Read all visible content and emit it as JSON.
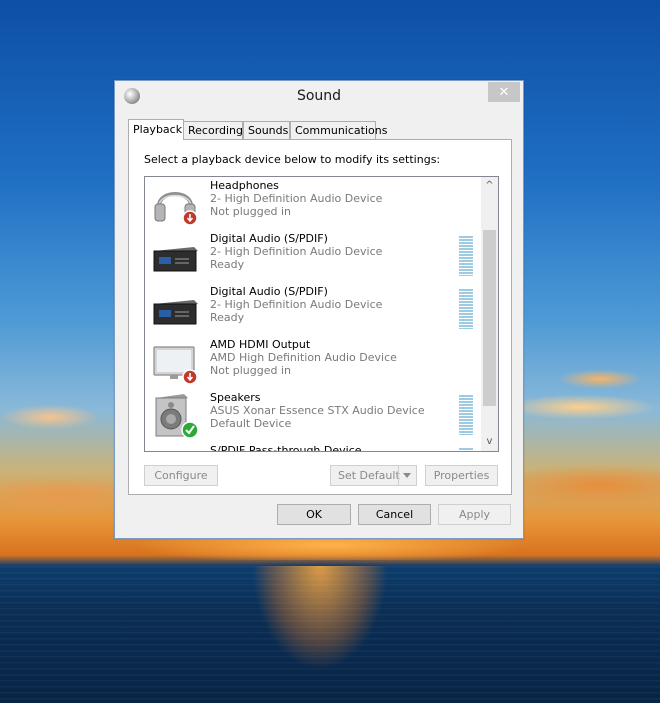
{
  "window": {
    "title": "Sound",
    "close_glyph": "✕"
  },
  "tabs": [
    {
      "label": "Playback",
      "active": true
    },
    {
      "label": "Recording",
      "active": false
    },
    {
      "label": "Sounds",
      "active": false
    },
    {
      "label": "Communications",
      "active": false
    }
  ],
  "playback": {
    "instructions": "Select a playback device below to modify its settings:",
    "devices": [
      {
        "name": "Headphones",
        "description": "2- High Definition Audio Device",
        "status": "Not plugged in",
        "icon": "headphones-icon",
        "badge": "unplugged-badge",
        "has_meter": false
      },
      {
        "name": "Digital Audio (S/PDIF)",
        "description": "2- High Definition Audio Device",
        "status": "Ready",
        "icon": "spdif-device-icon",
        "badge": "",
        "has_meter": true
      },
      {
        "name": "Digital Audio (S/PDIF)",
        "description": "2- High Definition Audio Device",
        "status": "Ready",
        "icon": "spdif-device-icon",
        "badge": "",
        "has_meter": true
      },
      {
        "name": "AMD HDMI Output",
        "description": "AMD High Definition Audio Device",
        "status": "Not plugged in",
        "icon": "monitor-icon",
        "badge": "unplugged-badge",
        "has_meter": false
      },
      {
        "name": "Speakers",
        "description": "ASUS Xonar Essence STX Audio Device",
        "status": "Default Device",
        "icon": "speaker-icon",
        "badge": "default-check-badge",
        "has_meter": true
      },
      {
        "name": "S/PDIF Pass-through Device",
        "description": "",
        "status": "",
        "icon": "spdif-device-icon",
        "badge": "",
        "has_meter": true
      }
    ],
    "scroll_up_glyph": "^",
    "scroll_down_glyph": "v",
    "configure_label": "Configure",
    "set_default_label": "Set Default",
    "properties_label": "Properties"
  },
  "footer": {
    "ok_label": "OK",
    "cancel_label": "Cancel",
    "apply_label": "Apply"
  },
  "colors": {
    "accent_meter": "#9ccbe2",
    "check_green": "#2fa83a",
    "unplugged_red": "#c0392b"
  }
}
